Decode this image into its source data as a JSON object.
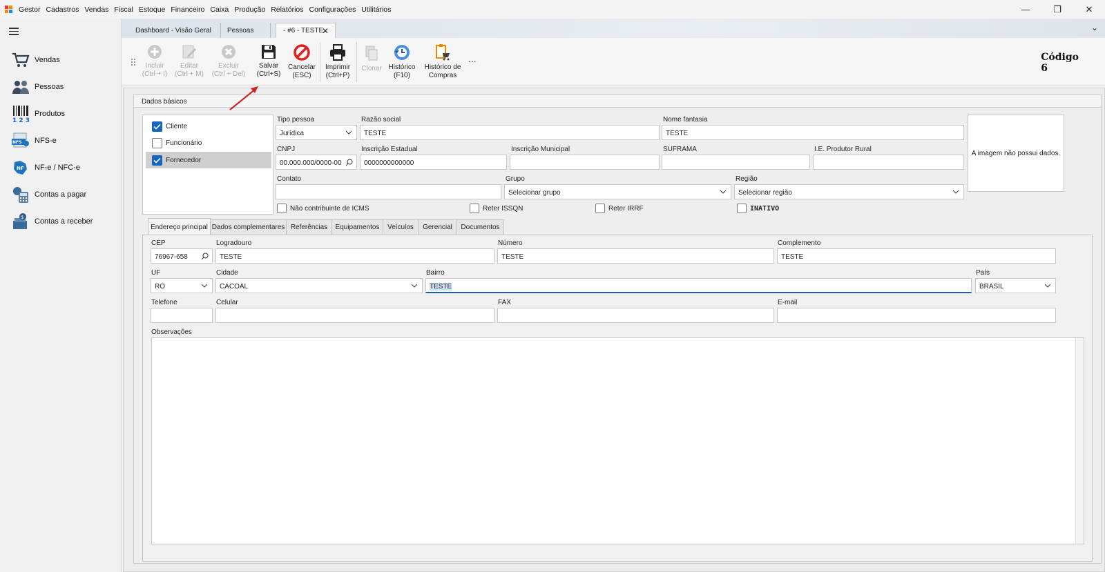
{
  "app": {
    "menu": [
      "Gestor",
      "Cadastros",
      "Vendas",
      "Fiscal",
      "Estoque",
      "Financeiro",
      "Caixa",
      "Produção",
      "Relatórios",
      "Configurações",
      "Utilitários"
    ],
    "window_controls": [
      "—",
      "❐",
      "✕"
    ]
  },
  "sidebar": {
    "items": [
      {
        "label": "Vendas",
        "icon": "cart-icon"
      },
      {
        "label": "Pessoas",
        "icon": "people-icon"
      },
      {
        "label": "Produtos",
        "icon": "barcode-icon"
      },
      {
        "label": "NFS-e",
        "icon": "nfse-icon"
      },
      {
        "label": "NF-e / NFC-e",
        "icon": "nfe-icon"
      },
      {
        "label": "Contas a pagar",
        "icon": "calculator-icon"
      },
      {
        "label": "Contas a receber",
        "icon": "money-icon"
      }
    ]
  },
  "tabs": {
    "items": [
      "Dashboard - Visão Geral",
      "Pessoas",
      "- #6 - TESTE"
    ],
    "close": "✕",
    "scroll": "⌄"
  },
  "toolbar": {
    "incluir": [
      "Incluir",
      "(Ctrl + I)"
    ],
    "editar": [
      "Editar",
      "(Ctrl + M)"
    ],
    "excluir": [
      "Excluir",
      "(Ctrl + Del)"
    ],
    "salvar": [
      "Salvar",
      "(Ctrl+S)"
    ],
    "cancelar": [
      "Cancelar",
      "(ESC)"
    ],
    "imprimir": [
      "Imprimir",
      "(Ctrl+P)"
    ],
    "clonar": [
      "Clonar"
    ],
    "historico": [
      "Histórico",
      "(F10)"
    ],
    "historico_compras": [
      "Histórico de",
      "Compras"
    ],
    "more": "...",
    "codigo_label": "Código",
    "codigo_value": "6"
  },
  "dados_basicos": {
    "title": "Dados básicos",
    "types": [
      {
        "label": "Cliente",
        "checked": true
      },
      {
        "label": "Funcionário",
        "checked": false
      },
      {
        "label": "Fornecedor",
        "checked": true
      }
    ],
    "tipo_pessoa": {
      "label": "Tipo pessoa",
      "value": "Jurídica"
    },
    "razao_social": {
      "label": "Razão social",
      "value": "TESTE"
    },
    "nome_fantasia": {
      "label": "Nome fantasia",
      "value": "TESTE"
    },
    "cnpj": {
      "label": "CNPJ",
      "value": "00.000.000/0000-00"
    },
    "inscricao_estadual": {
      "label": "Inscrição Estadual",
      "value": "0000000000000"
    },
    "inscricao_municipal": {
      "label": "Inscrição Municipal",
      "value": ""
    },
    "suframa": {
      "label": "SUFRAMA",
      "value": ""
    },
    "ie_produtor": {
      "label": "I.E. Produtor Rural",
      "value": ""
    },
    "contato": {
      "label": "Contato",
      "value": ""
    },
    "grupo": {
      "label": "Grupo",
      "value": "Selecionar grupo"
    },
    "regiao": {
      "label": "Região",
      "value": "Selecionar região"
    },
    "nao_contribuinte": "Não contribuinte de ICMS",
    "reter_issqn": "Reter ISSQN",
    "reter_irrf": "Reter IRRF",
    "inativo": "INATIVO",
    "image_text": "A imagem não possui dados."
  },
  "inner_tabs": [
    "Endereço principal",
    "Dados complementares",
    "Referências",
    "Equipamentos",
    "Veículos",
    "Gerencial",
    "Documentos"
  ],
  "endereco": {
    "cep": {
      "label": "CEP",
      "value": "76967-658"
    },
    "logradouro": {
      "label": "Logradouro",
      "value": "TESTE"
    },
    "numero": {
      "label": "Número",
      "value": "TESTE"
    },
    "complemento": {
      "label": "Complemento",
      "value": "TESTE"
    },
    "uf": {
      "label": "UF",
      "value": "RO"
    },
    "cidade": {
      "label": "Cidade",
      "value": "CACOAL"
    },
    "bairro": {
      "label": "Bairro",
      "value": "TESTE"
    },
    "pais": {
      "label": "País",
      "value": "BRASIL"
    },
    "telefone": {
      "label": "Telefone",
      "value": ""
    },
    "celular": {
      "label": "Celular",
      "value": ""
    },
    "fax": {
      "label": "FAX",
      "value": ""
    },
    "email": {
      "label": "E-mail",
      "value": ""
    },
    "observacoes": {
      "label": "Observações",
      "value": ""
    }
  },
  "colors": {
    "accent": "#1565c0",
    "cancel": "#e02020",
    "arrow": "#c62828"
  }
}
